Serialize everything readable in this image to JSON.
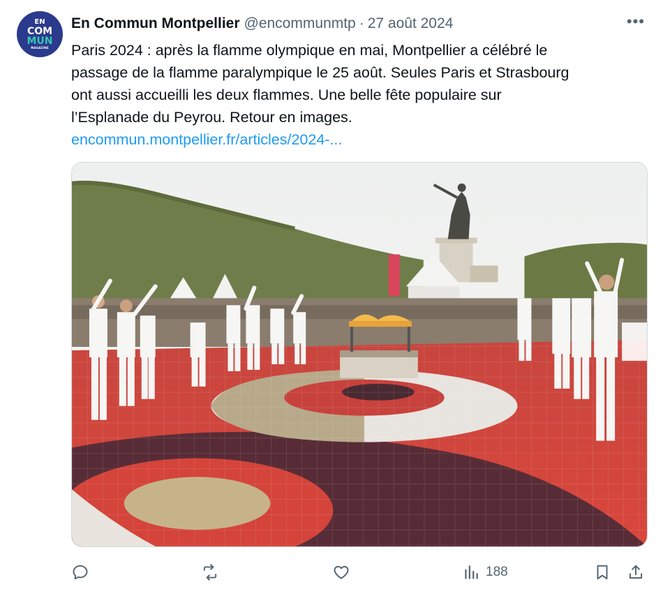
{
  "account": {
    "avatar_lines": [
      "EN",
      "COM",
      "MUN",
      "MAGAZINE"
    ],
    "name": "En Commun Montpellier",
    "handle": "@encommunmtp",
    "separator": "·",
    "date": "27 août 2024",
    "more_glyph": "•••"
  },
  "tweet": {
    "lines": [
      "Paris 2024 : après la flamme olympique en mai,  Montpellier a célébré le",
      "passage de la flamme paralympique le 25 août. Seules Paris et Strasbourg",
      "ont aussi accueilli les deux flammes. Une belle fête populaire sur",
      "l’Esplanade du Peyrou. Retour en images."
    ],
    "link": "encommun.montpellier.fr/articles/2024-..."
  },
  "actions": {
    "reply_icon": "reply-icon",
    "retweet_icon": "retweet-icon",
    "like_icon": "heart-icon",
    "views_icon": "analytics-icon",
    "views_count": "188",
    "bookmark_icon": "bookmark-icon",
    "share_icon": "share-icon"
  },
  "colors": {
    "link": "#1d9bf0",
    "text": "#0f1419",
    "muted": "#536471",
    "avatar_bg": "#2a3a8c",
    "avatar_accent": "#35c4b4"
  }
}
